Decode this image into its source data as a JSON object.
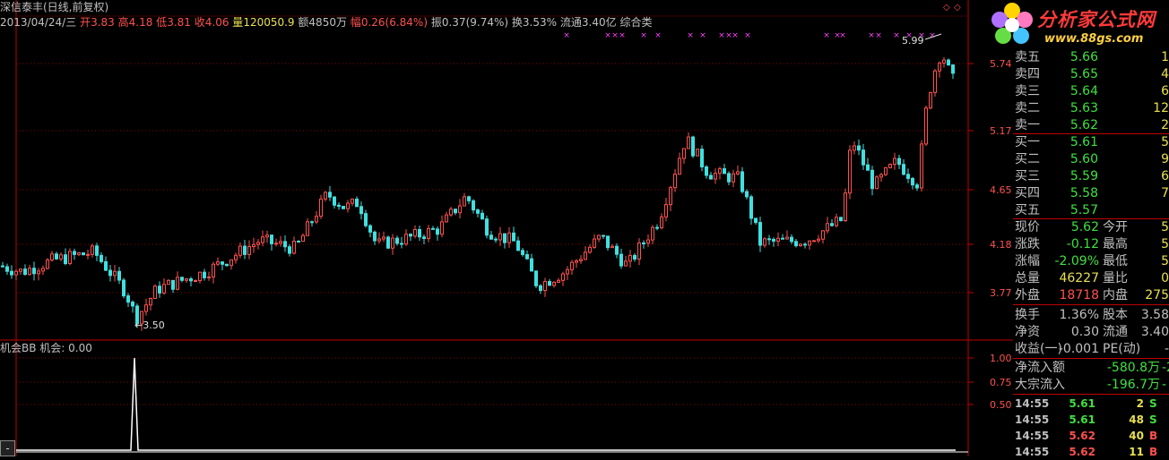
{
  "header": {
    "stock_title": "深信泰丰(日线,前复权)",
    "date_weekday": "2013/04/24/三",
    "open_label": "开",
    "open_value": "3.83",
    "high_label": "高",
    "high_value": "4.18",
    "low_label": "低",
    "low_value": "3.81",
    "close_label": "收",
    "close_value": "4.06",
    "volume_label": "量",
    "volume_value": "120050.9",
    "amount_label": "额",
    "amount_value": "4850万",
    "change_label": "幅",
    "change_value": "0.26(6.84%)",
    "amplitude_label": "振",
    "amplitude_value": "0.37(9.74%)",
    "turnover_label": "换",
    "turnover_value": "3.53%",
    "float_label": "流通",
    "float_value": "3.40亿",
    "sector_value": "综合类"
  },
  "price_axis": [
    "5.74",
    "5.17",
    "4.65",
    "4.18",
    "3.77"
  ],
  "chart_annotations": {
    "high_marker": "5.99",
    "low_marker": "3.50"
  },
  "indicator": {
    "title": "机会BB 机会: 0.00",
    "axis": [
      "1.00",
      "0.75",
      "0.50"
    ]
  },
  "logo": {
    "brand": "分析家公式网",
    "url_text": "www.88gs.com"
  },
  "order_book": [
    {
      "label": "卖五",
      "price": "5.66",
      "vol": "1"
    },
    {
      "label": "卖四",
      "price": "5.65",
      "vol": "4"
    },
    {
      "label": "卖三",
      "price": "5.64",
      "vol": "6"
    },
    {
      "label": "卖二",
      "price": "5.63",
      "vol": "12"
    },
    {
      "label": "卖一",
      "price": "5.62",
      "vol": "2"
    },
    {
      "label": "买一",
      "price": "5.61",
      "vol": "5"
    },
    {
      "label": "买二",
      "price": "5.60",
      "vol": "9"
    },
    {
      "label": "买三",
      "price": "5.59",
      "vol": "6"
    },
    {
      "label": "买四",
      "price": "5.58",
      "vol": "7"
    },
    {
      "label": "买五",
      "price": "5.57",
      "vol": ""
    }
  ],
  "quote": [
    {
      "l1": "现价",
      "v1": "5.62",
      "l2": "今开",
      "v2": "5"
    },
    {
      "l1": "涨跌",
      "v1": "-0.12",
      "l2": "最高",
      "v2": "5"
    },
    {
      "l1": "涨幅",
      "v1": "-2.09%",
      "l2": "最低",
      "v2": "5"
    },
    {
      "l1": "总量",
      "v1": "46227",
      "l2": "量比",
      "v2": "0"
    },
    {
      "l1": "外盘",
      "v1": "18718",
      "l2": "内盘",
      "v2": "275"
    }
  ],
  "fundamentals": [
    {
      "l1": "换手",
      "v1": "1.36%",
      "l2": "股本",
      "v2": "3.58"
    },
    {
      "l1": "净资",
      "v1": "0.30",
      "l2": "流通",
      "v2": "3.40"
    },
    {
      "l1": "收益(一)",
      "v1": "-0.001",
      "l2": "PE(动)",
      "v2": "-"
    }
  ],
  "flows": [
    {
      "label": "净流入额",
      "value": "-580.8万",
      "extra": "-2"
    },
    {
      "label": "大宗流入",
      "value": "-196.7万",
      "extra": "-"
    }
  ],
  "ticks": [
    {
      "time": "14:55",
      "price": "5.61",
      "vol": "2",
      "side": "S"
    },
    {
      "time": "14:55",
      "price": "5.61",
      "vol": "48",
      "side": "S"
    },
    {
      "time": "14:55",
      "price": "5.62",
      "vol": "40",
      "side": "B"
    },
    {
      "time": "14:55",
      "price": "5.62",
      "vol": "11",
      "side": "B"
    }
  ],
  "corner_button": "-",
  "colors": {
    "up": "#ff5050",
    "down": "#40e0e0",
    "grid": "#8b0000",
    "signal": "#ff40ff",
    "panel_border": "#c00000"
  }
}
